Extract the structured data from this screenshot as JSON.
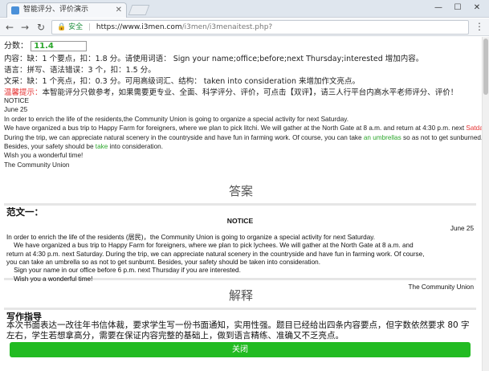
{
  "browser": {
    "tab_title": "智能评分、评价演示",
    "secure_label": "安全",
    "url_host": "https://www.i3men.com",
    "url_path": "/i3men/i3menaitest.php?"
  },
  "score": {
    "label": "分数：",
    "value": "11.4"
  },
  "feedback": {
    "content": "内容：缺：1 个要点，扣：1.8 分。请使用词语： Sign your name;office;before;next Thursday;interested 增加内容。",
    "language": "语言：拼写、语法错误：3 个，扣：1.5 分。",
    "style": "文采：缺：1 个亮点，扣：0.3 分。可用高级词汇、结构： taken into consideration 来增加作文亮点。",
    "tip_label": "温馨提示：",
    "tip_text": "本智能评分只做参考，如果需要更专业、全面、科学评分、评价，可点击【双评】，请三人行平台内高水平老师评分、评价！"
  },
  "essay": {
    "title": "NOTICE",
    "date": "June 25",
    "line1": "In order to enrich the life of the residents,the Community Union is going to organize a special activity for next Saturday.",
    "line2_a": "We have organized a bus trip to Happy Farm for foreigners, where we plan to pick litchi. We will gather at the North Gate at 8 a.m. and return at 4:30 p.m. next ",
    "line2_err": "Satday",
    "line2_b": ".",
    "line3_a": "During the trip, we can appreciate natural scenery in the countryside and have fun in farming work. Of course, you can take ",
    "line3_hl": "an umbrellas",
    "line3_b": " so as not to get sunburned.",
    "line4_a": "Besides, your safety should be ",
    "line4_hl": "take",
    "line4_b": " into consideration.",
    "line5": "Wish you a wonderful time!",
    "line6": "The Community Union"
  },
  "answer": {
    "heading": "答案",
    "sample_title": "范文一：",
    "notice": "NOTICE",
    "date": "June 25",
    "p1": "In order to enrich the life of the residents (居民)，the Community Union is going to organize a special activity for next Saturday.",
    "p2a": "    We have organized a bus trip to Happy Farm for foreigners, where we plan to pick lychees. We will gather at the North Gate at 8 a.m. and",
    "p2b": "return at 4:30 p.m. next Saturday. During the trip, we can appreciate natural scenery in the countryside and have fun in farming work. Of course,",
    "p2c": "you can take an umbrella so as not to get sunburnt. Besides, your safety should be taken into consideration.",
    "p3": "    Sign your name in our office before 6 p.m. next Thursday if you are interested.",
    "p4": "    Wish you a wonderful time!",
    "sign": "The Community Union"
  },
  "explain": {
    "heading": "解释",
    "guide_title": "写作指导",
    "guide_text": "本次书面表达一改往年书信体裁，要求学生写一份书面通知，实用性强。题目已经给出四条内容要点，但字数依然要求 80 字左右，学生若想拿高分，需要在保证内容完整的基础上，做到语言精练、准确又不乏亮点。"
  },
  "close_label": "关闭",
  "colors": {
    "score_green": "#2aa52a",
    "warning_red": "#e53030",
    "button_green": "#22bb22"
  }
}
